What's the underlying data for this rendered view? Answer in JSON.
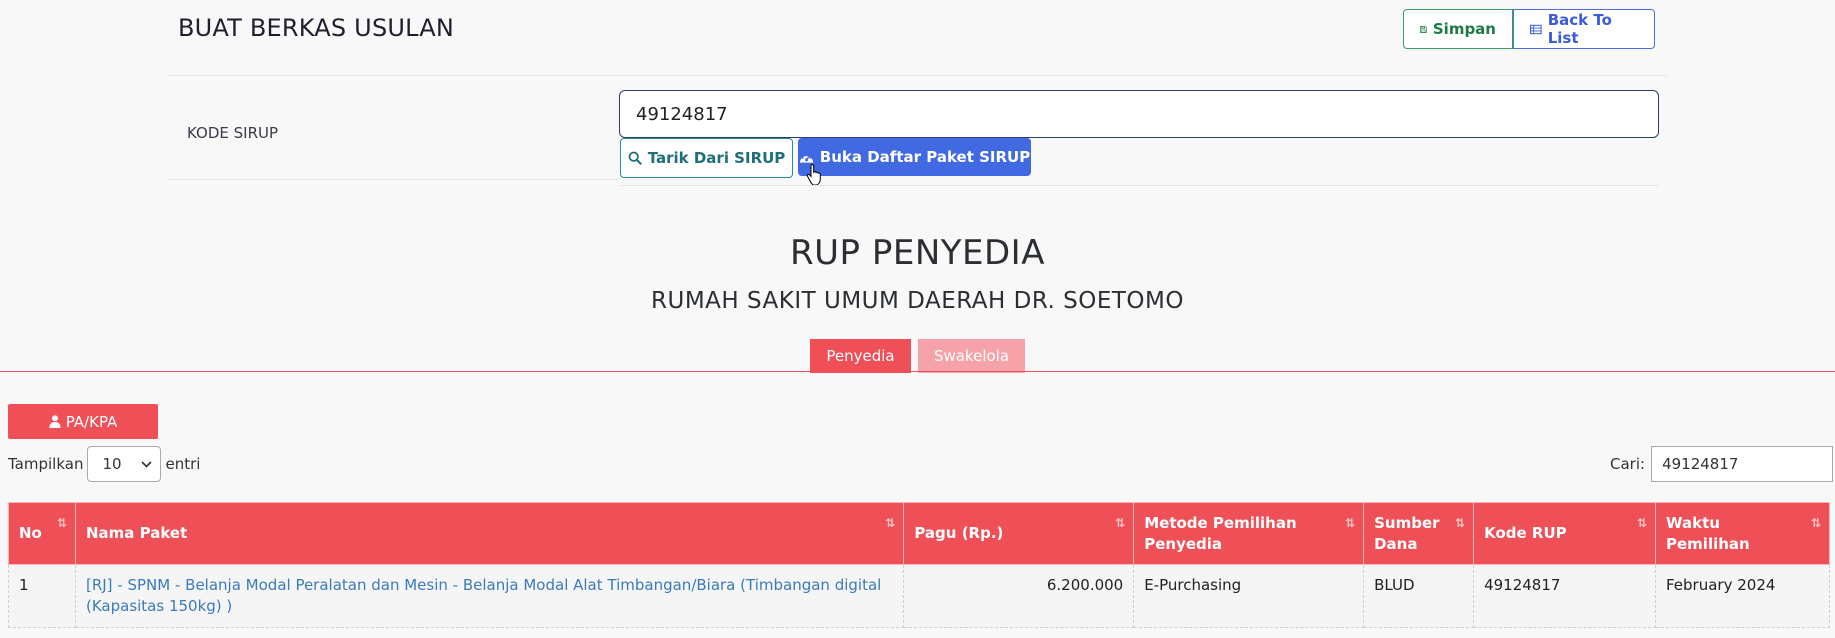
{
  "header": {
    "title": "BUAT BERKAS USULAN",
    "save_label": "Simpan",
    "back_label": "Back To List"
  },
  "form": {
    "kode_sirup_label": "KODE SIRUP",
    "kode_sirup_value": "49124817",
    "tarik_label": "Tarik Dari SIRUP",
    "buka_label": "Buka Daftar Paket SIRUP"
  },
  "rup": {
    "title": "RUP PENYEDIA",
    "subtitle": "RUMAH SAKIT UMUM DAERAH DR. SOETOMO",
    "tabs": [
      "Penyedia",
      "Swakelola"
    ],
    "pakpa_label": "PA/KPA"
  },
  "table_controls": {
    "show_label": "Tampilkan",
    "show_value": "10",
    "entries_label": "entri",
    "search_label": "Cari:",
    "search_value": "49124817"
  },
  "table": {
    "headers": [
      "No",
      "Nama Paket",
      "Pagu (Rp.)",
      "Metode Pemilihan Penyedia",
      "Sumber Dana",
      "Kode RUP",
      "Waktu Pemilihan"
    ],
    "rows": [
      {
        "no": "1",
        "nama_paket": "[RJ] - SPNM - Belanja Modal Peralatan dan Mesin - Belanja Modal Alat Timbangan/Biara (Timbangan digital (Kapasitas 150kg) )",
        "pagu": "6.200.000",
        "metode": "E-Purchasing",
        "sumber_dana": "BLUD",
        "kode_rup": "49124817",
        "waktu": "February 2024"
      }
    ]
  },
  "colors": {
    "accent_red": "#ef5058",
    "accent_red_light": "#f5a3a8",
    "primary_blue": "#4169e1",
    "save_green": "#1f7a45"
  }
}
